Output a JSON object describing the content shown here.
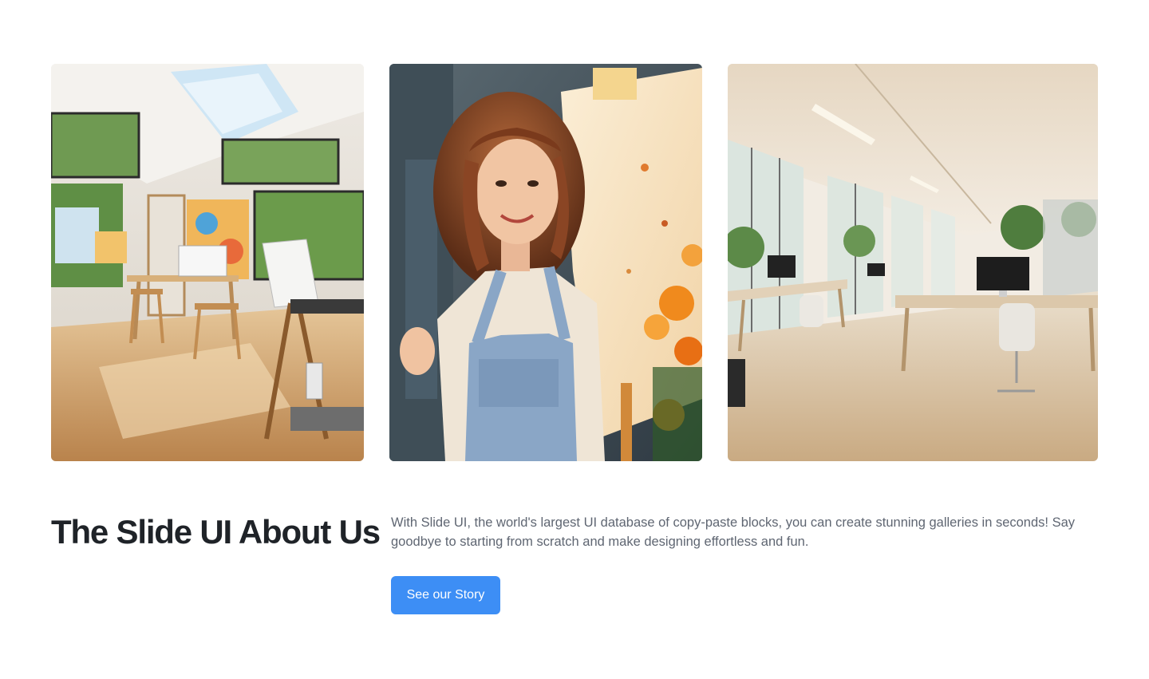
{
  "gallery": {
    "images": [
      {
        "icon": "art-studio-photo",
        "subject": "Sunlit art studio with easels and wooden stools"
      },
      {
        "icon": "artist-portrait-photo",
        "subject": "Smiling young woman in denim overalls beside an easel"
      },
      {
        "icon": "office-interior-photo",
        "subject": "Bright open-plan office with desks and computers"
      }
    ]
  },
  "about": {
    "title": "The Slide UI About Us",
    "body": "With Slide UI, the world's largest UI database of copy-paste blocks, you can create stunning galleries in seconds! Say goodbye to starting from scratch and make designing effortless and fun.",
    "cta_label": "See our Story"
  },
  "colors": {
    "heading": "#1f2328",
    "body": "#5f6672",
    "accent": "#3d8ef5",
    "background": "#ffffff"
  }
}
